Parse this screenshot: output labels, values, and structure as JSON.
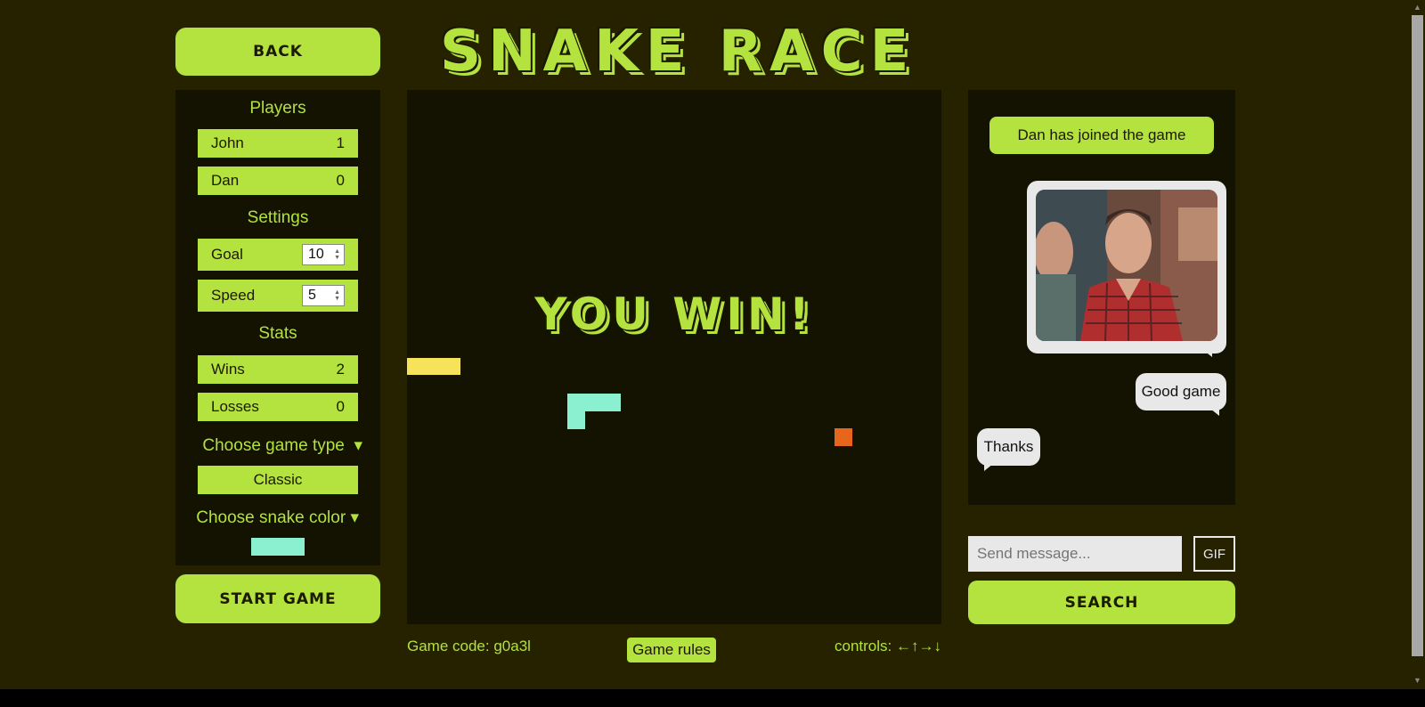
{
  "header": {
    "back_label": "BACK",
    "title": "SNAKE RACE"
  },
  "sidebar": {
    "players_title": "Players",
    "players": [
      {
        "name": "John",
        "score": "1"
      },
      {
        "name": "Dan",
        "score": "0"
      }
    ],
    "settings_title": "Settings",
    "settings": [
      {
        "label": "Goal",
        "value": "10"
      },
      {
        "label": "Speed",
        "value": "5"
      }
    ],
    "stats_title": "Stats",
    "stats": [
      {
        "label": "Wins",
        "value": "2"
      },
      {
        "label": "Losses",
        "value": "0"
      }
    ],
    "game_type_label": "Choose game type",
    "game_type_value": "Classic",
    "snake_color_label": "Choose snake color",
    "snake_color": "#8af0d0",
    "start_label": "START GAME",
    "dropdown_icon": "triangle-down-icon"
  },
  "board": {
    "message": "YOU WIN!",
    "snakes": [
      {
        "color": "#f7e35a"
      },
      {
        "color": "#8af0d0"
      }
    ],
    "food_color": "#e8661c"
  },
  "footer": {
    "game_code": "Game code: g0a3l",
    "rules_label": "Game rules",
    "controls": "controls: ←↑→↓"
  },
  "chat": {
    "system_message": "Dan has joined the game",
    "gif_alt": "animated GIF of a smiling man in a plaid shirt",
    "messages": [
      {
        "text": "Good game",
        "side": "right"
      },
      {
        "text": "Thanks",
        "side": "left"
      }
    ],
    "input_placeholder": "Send message...",
    "gif_button": "GIF",
    "search_button": "SEARCH"
  },
  "colors": {
    "background": "#262200",
    "panel": "#141200",
    "accent": "#b4e23f"
  }
}
